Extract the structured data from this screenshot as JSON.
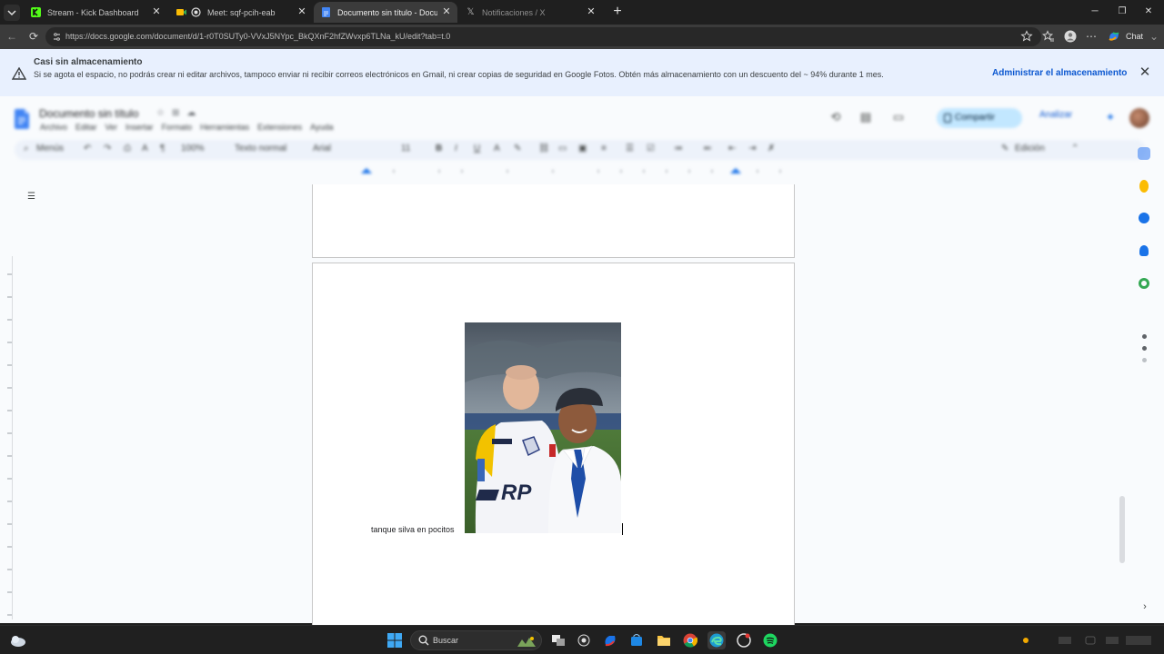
{
  "browser": {
    "tabs": [
      {
        "title": "Stream - Kick Dashboard",
        "icon": "kick-icon",
        "active": false
      },
      {
        "title": "Meet: sqf-pcih-eab",
        "icon": "meet-icon",
        "active": false
      },
      {
        "title": "Documento sin título - Document",
        "icon": "docs-icon",
        "active": true
      },
      {
        "title": "Notificaciones / X",
        "icon": "x-icon",
        "active": false
      }
    ],
    "url": "https://docs.google.com/document/d/1-r0T0SUTy0-VVxJ5NYpc_BkQXnF2hfZWvxp6TLNa_kU/edit?tab=t.0",
    "chat_label": "Chat"
  },
  "banner": {
    "title": "Casi sin almacenamiento",
    "message": "Si se agota el espacio, no podrás crear ni editar archivos, tampoco enviar ni recibir correos electrónicos en Gmail, ni crear copias de seguridad en Google Fotos. Obtén más almacenamiento con un descuento del ~ 94% durante 1 mes.",
    "manage_label": "Administrar el almacenamiento",
    "bg_color": "#e8f0fe",
    "link_color": "#0b57d0"
  },
  "docs": {
    "title": "Documento sin título",
    "menus": [
      "Archivo",
      "Editar",
      "Ver",
      "Insertar",
      "Formato",
      "Herramientas",
      "Extensiones",
      "Ayuda"
    ],
    "share_label": "Compartir",
    "gemini_label": "Analizar",
    "toolbar": {
      "menus_label": "Menús",
      "zoom": "100%",
      "style": "Texto normal",
      "font": "Arial",
      "font_size": "11",
      "edit_mode": "Edición"
    },
    "caption": "tanque silva en pocitos",
    "share_color": "#c2e7ff"
  },
  "taskbar": {
    "search_placeholder": "Buscar",
    "apps": [
      "task-view",
      "copilot",
      "m365",
      "store",
      "file-explorer",
      "chrome",
      "edge",
      "game",
      "spotify"
    ]
  }
}
